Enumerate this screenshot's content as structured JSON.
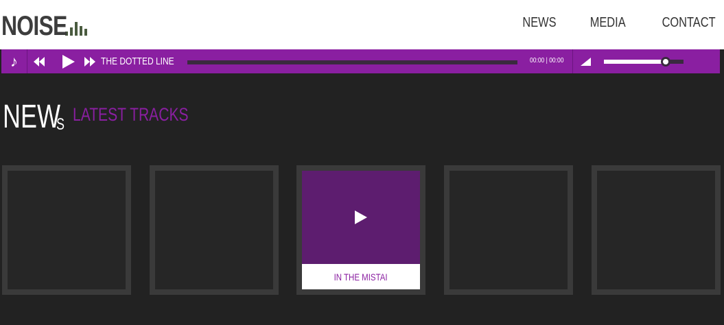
{
  "header": {
    "logo_text": "NOISE",
    "nav": [
      "NEWS",
      "MEDIA",
      "CONTACT"
    ]
  },
  "player": {
    "track_title": "THE DOTTED LINE",
    "time": "00:00 | 00:00",
    "progress": 0,
    "volume": 0.78,
    "icons": [
      "music-note-icon",
      "rewind-icon",
      "play-icon",
      "fast-forward-icon",
      "volume-icon"
    ]
  },
  "section": {
    "title_big": "NEW",
    "title_small": "S",
    "subtitle": "LATEST TRACKS"
  },
  "tiles": [
    {
      "label": ""
    },
    {
      "label": ""
    },
    {
      "label": "IN THE MISTAI",
      "active": true
    },
    {
      "label": ""
    },
    {
      "label": ""
    }
  ],
  "colors": {
    "accent": "#8a1fa1",
    "background": "#222222",
    "tile_border": "#3a3a3a",
    "logo": "#3d3d3d",
    "logo_bars": "#4a5b3f"
  }
}
